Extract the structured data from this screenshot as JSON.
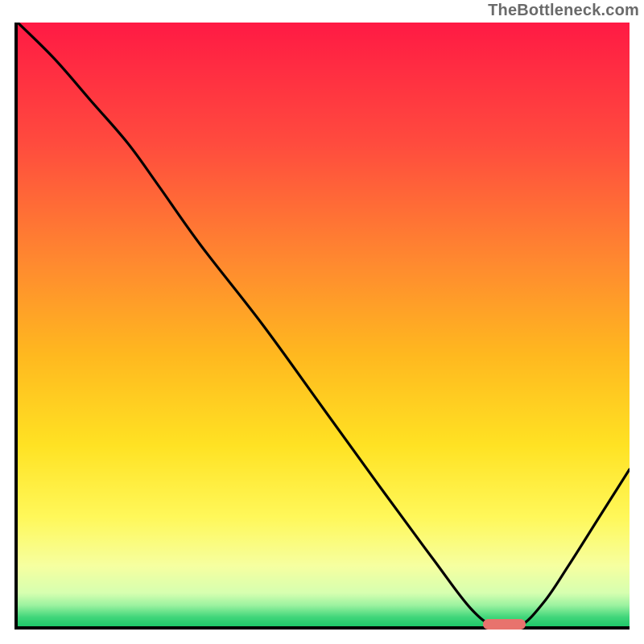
{
  "watermark": "TheBottleneck.com",
  "chart_data": {
    "type": "line",
    "title": "",
    "xlabel": "",
    "ylabel": "",
    "xlim": [
      0,
      100
    ],
    "ylim": [
      0,
      100
    ],
    "grid": false,
    "legend": false,
    "background_gradient": {
      "stops": [
        {
          "offset": 0.0,
          "color": "#ff1a44"
        },
        {
          "offset": 0.2,
          "color": "#ff4b3e"
        },
        {
          "offset": 0.4,
          "color": "#ff8a2f"
        },
        {
          "offset": 0.55,
          "color": "#ffb81f"
        },
        {
          "offset": 0.7,
          "color": "#ffe223"
        },
        {
          "offset": 0.82,
          "color": "#fff85a"
        },
        {
          "offset": 0.9,
          "color": "#f6ffa0"
        },
        {
          "offset": 0.945,
          "color": "#d6ffb0"
        },
        {
          "offset": 0.965,
          "color": "#9cf2a0"
        },
        {
          "offset": 0.985,
          "color": "#40d67a"
        },
        {
          "offset": 1.0,
          "color": "#1ec96a"
        }
      ]
    },
    "series": [
      {
        "name": "bottleneck-curve",
        "x": [
          0,
          6,
          12,
          18,
          23,
          30,
          40,
          50,
          60,
          68,
          74,
          78,
          82,
          86,
          90,
          95,
          100
        ],
        "values": [
          100,
          94,
          87,
          80,
          73,
          63,
          50,
          36,
          22,
          11,
          3,
          0,
          0,
          4,
          10,
          18,
          26
        ]
      }
    ],
    "minimum_marker": {
      "x_start": 76,
      "x_end": 83,
      "y": 0,
      "color": "#e8736d"
    },
    "annotations": []
  }
}
